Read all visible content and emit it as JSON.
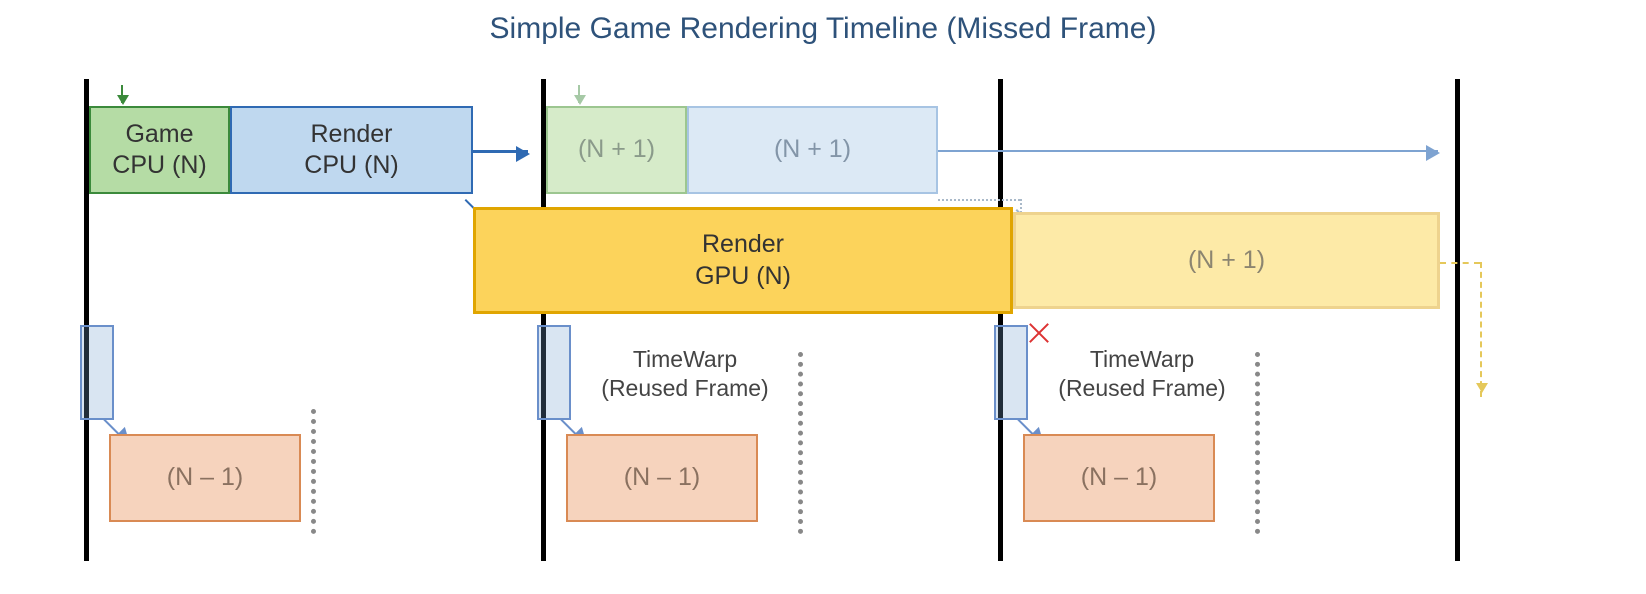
{
  "title": "Simple Game Rendering Timeline (Missed Frame)",
  "vsync_x": [
    84,
    541,
    998,
    1455
  ],
  "cpu": {
    "game_n": "Game\nCPU (N)",
    "render_n": "Render\nCPU (N)",
    "game_n1": "(N + 1)",
    "render_n1": "(N + 1)"
  },
  "gpu": {
    "render_n": "Render\nGPU (N)",
    "render_n1": "(N + 1)"
  },
  "timewarp_label_1": "TimeWarp\n(Reused Frame)",
  "timewarp_label_2": "TimeWarp\n(Reused Frame)",
  "display": {
    "n_minus_1_a": "(N – 1)",
    "n_minus_1_b": "(N – 1)",
    "n_minus_1_c": "(N – 1)"
  },
  "colors": {
    "green": "#b5dca5",
    "blue": "#bfd8ef",
    "yellow": "#fcd35b",
    "orange": "#f6d3bd",
    "title": "#2e527a"
  },
  "notes": {
    "missed_frame_marker": "red X at expected GPU-complete for frame N before third vsync"
  }
}
